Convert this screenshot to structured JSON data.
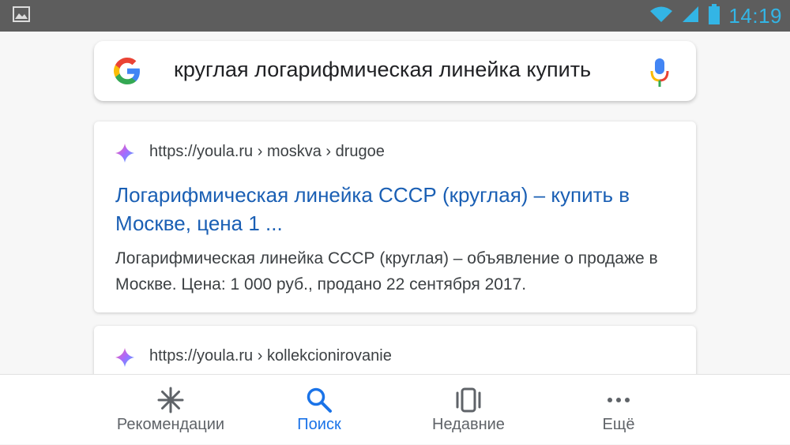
{
  "status_bar": {
    "time": "14:19",
    "icons": [
      "image-icon",
      "wifi-icon",
      "signal-icon",
      "battery-icon"
    ]
  },
  "search": {
    "query": "круглая логарифмическая линейка купить",
    "logo_icon": "google-g-icon",
    "mic_icon": "microphone-icon"
  },
  "results": [
    {
      "url": "https://youla.ru › moskva › drugoe",
      "title": "Логарифмическая линейка СССР (круглая) – купить в Москве, цена 1 ...",
      "snippet": "Логарифмическая линейка СССР (круглая) – объявление о продаже в Москве. Цена: 1 000 руб., продано 22 сентября 2017."
    },
    {
      "url": "https://youla.ru › kollekcionirovanie"
    }
  ],
  "bottom_nav": {
    "items": [
      {
        "label": "Рекомендации",
        "icon": "asterisk-icon",
        "active": false
      },
      {
        "label": "Поиск",
        "icon": "search-icon",
        "active": true
      },
      {
        "label": "Недавние",
        "icon": "recent-cards-icon",
        "active": false
      },
      {
        "label": "Ещё",
        "icon": "more-dots-icon",
        "active": false
      }
    ]
  },
  "colors": {
    "accent": "#1a73e8",
    "link": "#1a5fb4",
    "status_bar": "#5d5d5d",
    "clock": "#33b5e5"
  }
}
